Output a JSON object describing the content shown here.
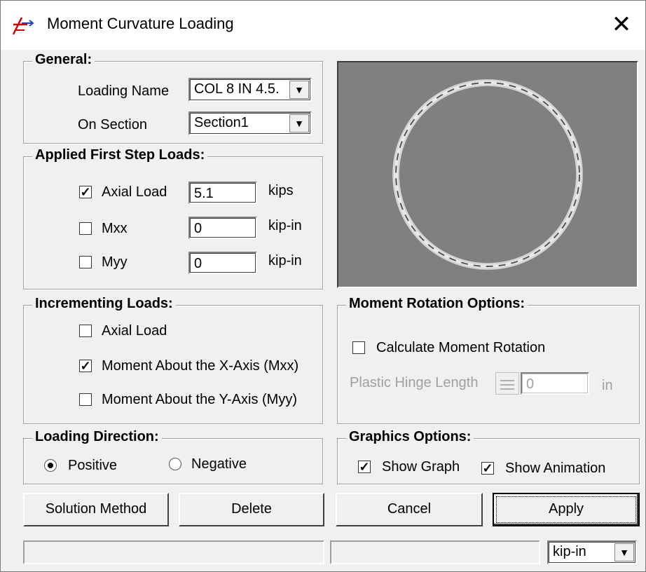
{
  "window": {
    "title": "Moment Curvature Loading",
    "close_glyph": "✕"
  },
  "general": {
    "group_label": "General:",
    "loading_name_label": "Loading Name",
    "loading_name_value": "COL 8 IN 4.5.",
    "on_section_label": "On Section",
    "on_section_value": "Section1"
  },
  "first_step": {
    "group_label": "Applied First Step Loads:",
    "rows": [
      {
        "label": "Axial Load",
        "checked": true,
        "value": "5.1",
        "unit": "kips"
      },
      {
        "label": "Mxx",
        "checked": false,
        "value": "0",
        "unit": "kip-in"
      },
      {
        "label": "Myy",
        "checked": false,
        "value": "0",
        "unit": "kip-in"
      }
    ]
  },
  "incrementing": {
    "group_label": "Incrementing Loads:",
    "rows": [
      {
        "label": "Axial Load",
        "checked": false
      },
      {
        "label": "Moment About the X-Axis (Mxx)",
        "checked": true
      },
      {
        "label": "Moment About the Y-Axis (Myy)",
        "checked": false
      }
    ]
  },
  "moment_rotation": {
    "group_label": "Moment Rotation Options:",
    "calc_label": "Calculate Moment Rotation",
    "calc_checked": false,
    "hinge_label": "Plastic Hinge Length",
    "hinge_value": "0",
    "hinge_unit": "in"
  },
  "loading_direction": {
    "group_label": "Loading Direction:",
    "positive_label": "Positive",
    "negative_label": "Negative",
    "selected": "Positive"
  },
  "graphics": {
    "group_label": "Graphics Options:",
    "show_graph_label": "Show Graph",
    "show_graph_checked": true,
    "show_animation_label": "Show Animation",
    "show_animation_checked": true
  },
  "buttons": {
    "solution_method": "Solution Method",
    "delete": "Delete",
    "cancel": "Cancel",
    "apply": "Apply"
  },
  "statusbar": {
    "units_value": "kip-in"
  },
  "colors": {
    "canvas_bg": "#808080",
    "section_ring": "#e8e8e8"
  }
}
